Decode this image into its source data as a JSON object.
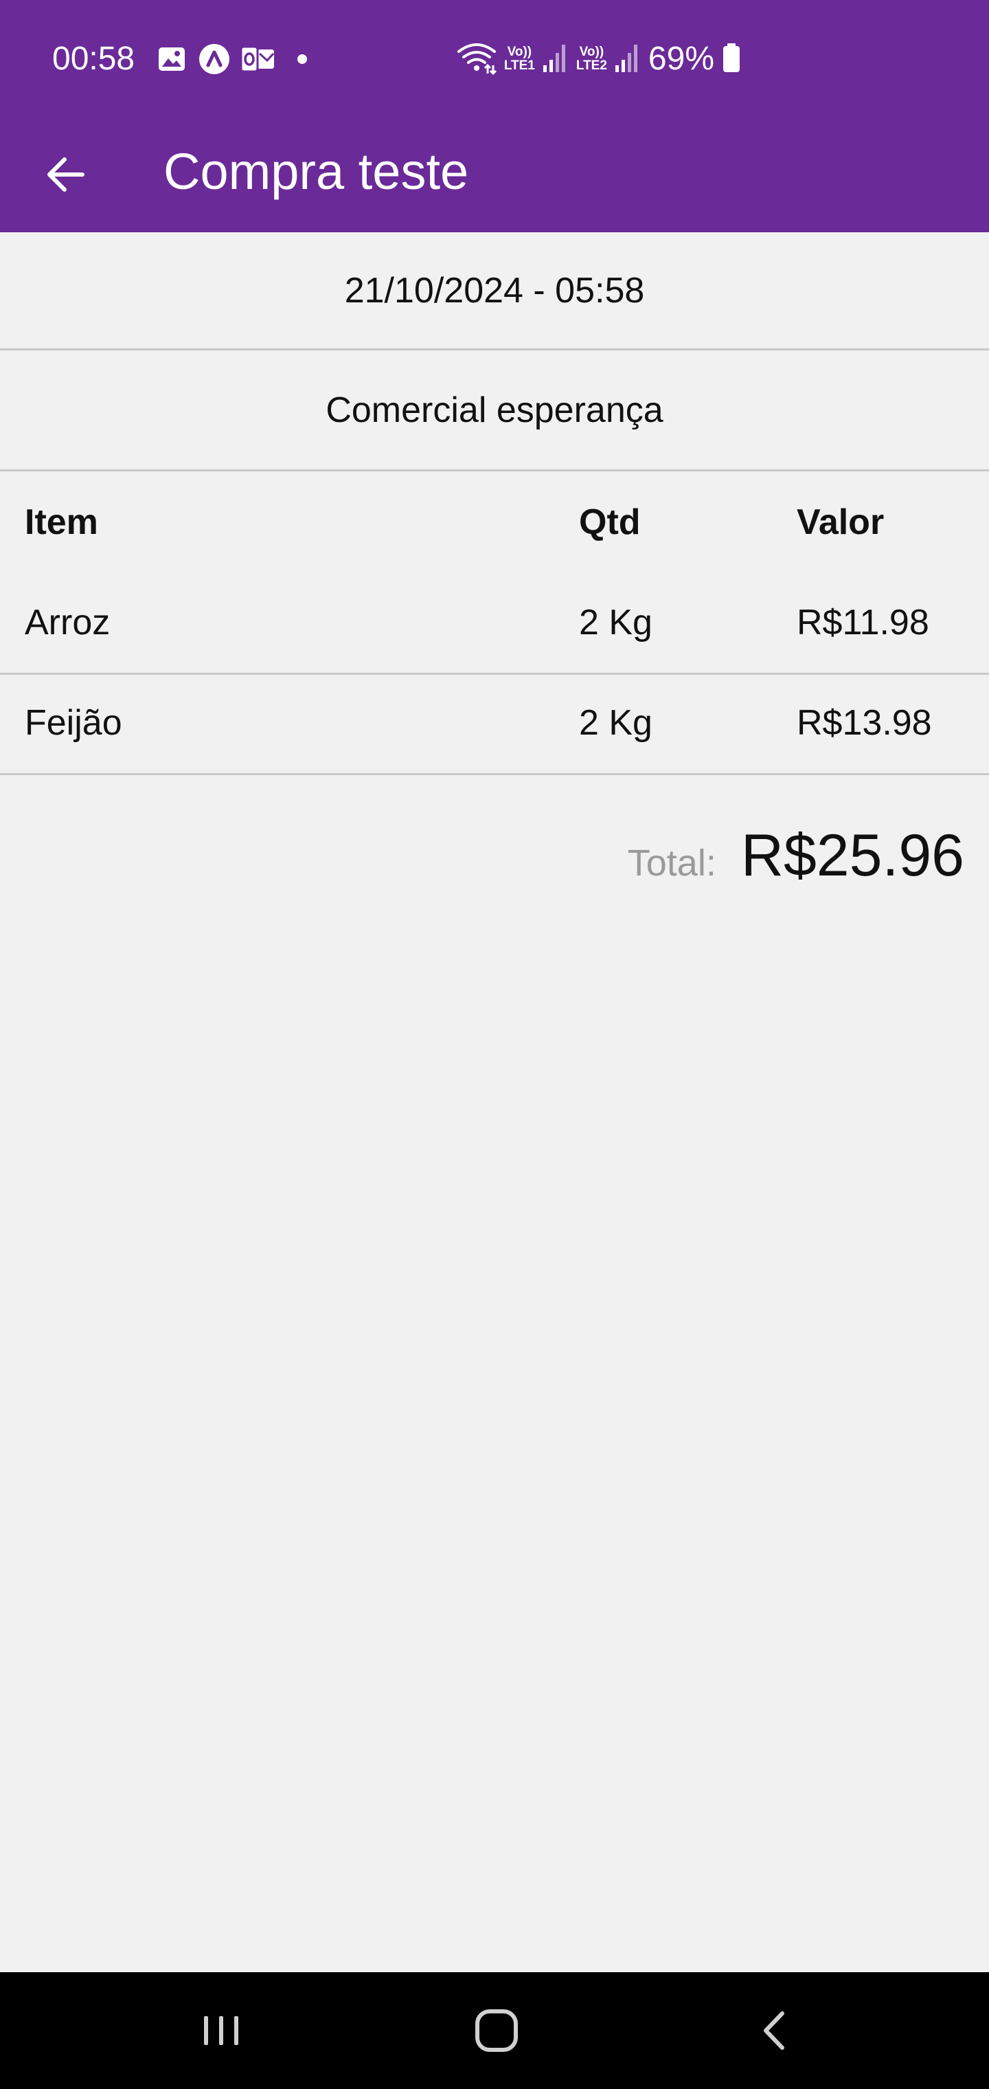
{
  "status_bar": {
    "time": "00:58",
    "battery": "69%",
    "icons": [
      "gallery-icon",
      "app-icon",
      "outlook-icon",
      "dot-icon",
      "wifi-icon",
      "volte-lte1-icon",
      "signal-icon",
      "volte-lte2-icon",
      "signal-icon",
      "battery-icon"
    ],
    "sim1_label": "LTE1",
    "sim2_label": "LTE2",
    "volte_label": "Vo))"
  },
  "app_bar": {
    "title": "Compra teste",
    "back_icon": "arrow-left-icon",
    "color": "#6a2a98"
  },
  "purchase": {
    "datetime": "21/10/2024 - 05:58",
    "store": "Comercial esperança"
  },
  "table": {
    "headers": {
      "item": "Item",
      "qtd": "Qtd",
      "valor": "Valor"
    },
    "rows": [
      {
        "item": "Arroz",
        "qtd": "2 Kg",
        "valor": "R$11.98"
      },
      {
        "item": "Feijão",
        "qtd": "2 Kg",
        "valor": "R$13.98"
      }
    ]
  },
  "total": {
    "label": "Total:",
    "value": "R$25.96"
  },
  "nav_bar": {
    "icons": [
      "recent-apps-icon",
      "home-icon",
      "back-icon"
    ]
  }
}
